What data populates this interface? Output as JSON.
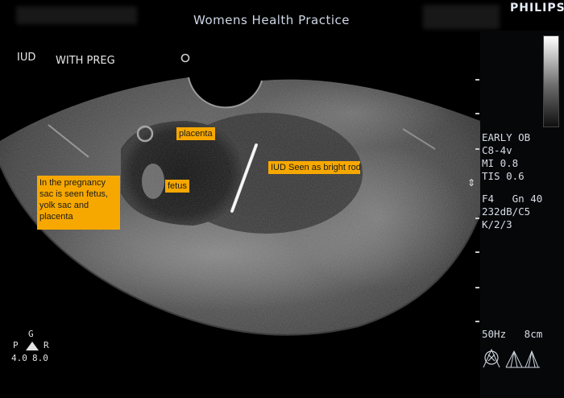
{
  "header": {
    "title": "Womens Health Practice",
    "brand": "PHILIPS"
  },
  "labels": {
    "iud": "IUD",
    "with_preg": "WITH PREG"
  },
  "annotations": {
    "placenta": "placenta",
    "fetus": "fetus",
    "iud": "IUD Seen as bright rod",
    "sac": "In the pregnancy sac is seen fetus, yolk sac and placenta"
  },
  "parameters": {
    "preset": "EARLY OB",
    "probe": "C8-4v",
    "mi": "MI 0.8",
    "tis": "TIS 0.6",
    "freq_gain": "F4   Gn 40",
    "dynamic": "232dB/C5",
    "persistence": "K/2/3",
    "frame_depth": "50Hz   8cm"
  },
  "orientation": {
    "g": "G",
    "p": "P",
    "r": "R",
    "n1": "4.0",
    "n2": "8.0"
  },
  "colors": {
    "annotation_bg": "#f7a800",
    "annotation_text": "#1b1b1b",
    "screen_bg": "#000000",
    "text": "#d7dde6"
  }
}
